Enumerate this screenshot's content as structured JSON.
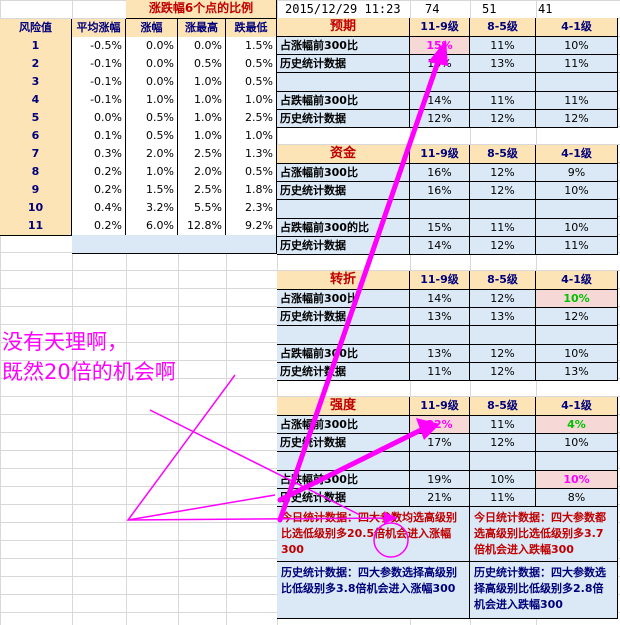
{
  "datetime": "2015/12/29 11:23",
  "top_numbers": [
    "74",
    "51",
    "41"
  ],
  "left_table": {
    "banner": "涨跌幅6个点的比例",
    "headers": [
      "风险值",
      "平均涨幅",
      "涨幅",
      "涨最高",
      "跌最低"
    ],
    "rows": [
      [
        "1",
        "-0.5%",
        "0.0%",
        "0.0%",
        "1.5%"
      ],
      [
        "2",
        "-0.1%",
        "0.0%",
        "0.5%",
        "0.5%"
      ],
      [
        "3",
        "-0.1%",
        "0.0%",
        "1.0%",
        "0.5%"
      ],
      [
        "4",
        "-0.1%",
        "1.0%",
        "1.0%",
        "1.0%"
      ],
      [
        "5",
        "0.0%",
        "0.5%",
        "1.0%",
        "2.5%"
      ],
      [
        "6",
        "0.1%",
        "0.5%",
        "1.0%",
        "1.0%"
      ],
      [
        "7",
        "0.3%",
        "2.0%",
        "2.5%",
        "1.3%"
      ],
      [
        "8",
        "0.2%",
        "1.0%",
        "2.0%",
        "0.5%"
      ],
      [
        "9",
        "0.2%",
        "1.5%",
        "2.5%",
        "1.8%"
      ],
      [
        "10",
        "0.4%",
        "3.2%",
        "5.5%",
        "2.3%"
      ],
      [
        "11",
        "0.2%",
        "6.0%",
        "12.8%",
        "9.2%"
      ]
    ]
  },
  "sections": [
    {
      "name": "预期",
      "cols": [
        "11-9级",
        "8-5级",
        "4-1级"
      ],
      "rows": [
        {
          "label": "占涨幅前300比",
          "vals": [
            "15%",
            "11%",
            "10%"
          ]
        },
        {
          "label": "历史统计数据",
          "vals": [
            "13%",
            "13%",
            "11%"
          ]
        },
        {
          "label": "",
          "vals": [
            "",
            "",
            ""
          ]
        },
        {
          "label": "占跌幅前300比",
          "vals": [
            "14%",
            "11%",
            "11%"
          ]
        },
        {
          "label": "历史统计数据",
          "vals": [
            "12%",
            "12%",
            "12%"
          ]
        }
      ]
    },
    {
      "name": "资金",
      "cols": [
        "11-9级",
        "8-5级",
        "4-1级"
      ],
      "rows": [
        {
          "label": "占涨幅前300比",
          "vals": [
            "16%",
            "12%",
            "9%"
          ]
        },
        {
          "label": "历史统计数据",
          "vals": [
            "16%",
            "12%",
            "10%"
          ]
        },
        {
          "label": "",
          "vals": [
            "",
            "",
            ""
          ]
        },
        {
          "label": "占跌幅前300的比",
          "vals": [
            "15%",
            "11%",
            "10%"
          ]
        },
        {
          "label": "历史统计数据",
          "vals": [
            "14%",
            "12%",
            "11%"
          ]
        }
      ]
    },
    {
      "name": "转折",
      "cols": [
        "11-9级",
        "8-5级",
        "4-1级"
      ],
      "rows": [
        {
          "label": "占涨幅前300比",
          "vals": [
            "14%",
            "12%",
            "10%"
          ]
        },
        {
          "label": "历史统计数据",
          "vals": [
            "13%",
            "13%",
            "12%"
          ]
        },
        {
          "label": "",
          "vals": [
            "",
            "",
            ""
          ]
        },
        {
          "label": "占跌幅前300比",
          "vals": [
            "13%",
            "12%",
            "10%"
          ]
        },
        {
          "label": "历史统计数据",
          "vals": [
            "11%",
            "12%",
            "13%"
          ]
        }
      ]
    },
    {
      "name": "强度",
      "cols": [
        "11-9级",
        "8-5级",
        "4-1级"
      ],
      "rows": [
        {
          "label": "占涨幅前300比",
          "vals": [
            "22%",
            "11%",
            "4%"
          ]
        },
        {
          "label": "历史统计数据",
          "vals": [
            "17%",
            "12%",
            "10%"
          ]
        },
        {
          "label": "",
          "vals": [
            "",
            "",
            ""
          ]
        },
        {
          "label": "占跌幅前300比",
          "vals": [
            "19%",
            "10%",
            "10%"
          ]
        },
        {
          "label": "历史统计数据",
          "vals": [
            "21%",
            "11%",
            "8%"
          ]
        }
      ]
    }
  ],
  "summary": {
    "today_left": "今日统计数据：四大参数均选高级别比选低级别多20.5倍机会进入涨幅300",
    "today_right": "今日统计数据：四大参数都选高级别比选低级别多3.7倍机会进入跌幅300",
    "hist_left": "历史统计数据：四大参数选择高级别比低级别多3.8倍机会进入涨幅300",
    "hist_right": "历史统计数据：四大参数选择高级别比低级别多2.8倍机会进入跌幅300"
  },
  "annotation": "没有天理啊，\n既然20倍的机会啊",
  "colors": {
    "header_bg": "#fce4b6",
    "cell_blue": "#dbe9f7",
    "cell_pink": "#f6d9d6",
    "annotation": "#ff00ff",
    "section_title": "#c00000",
    "header_text": "#00007a"
  }
}
